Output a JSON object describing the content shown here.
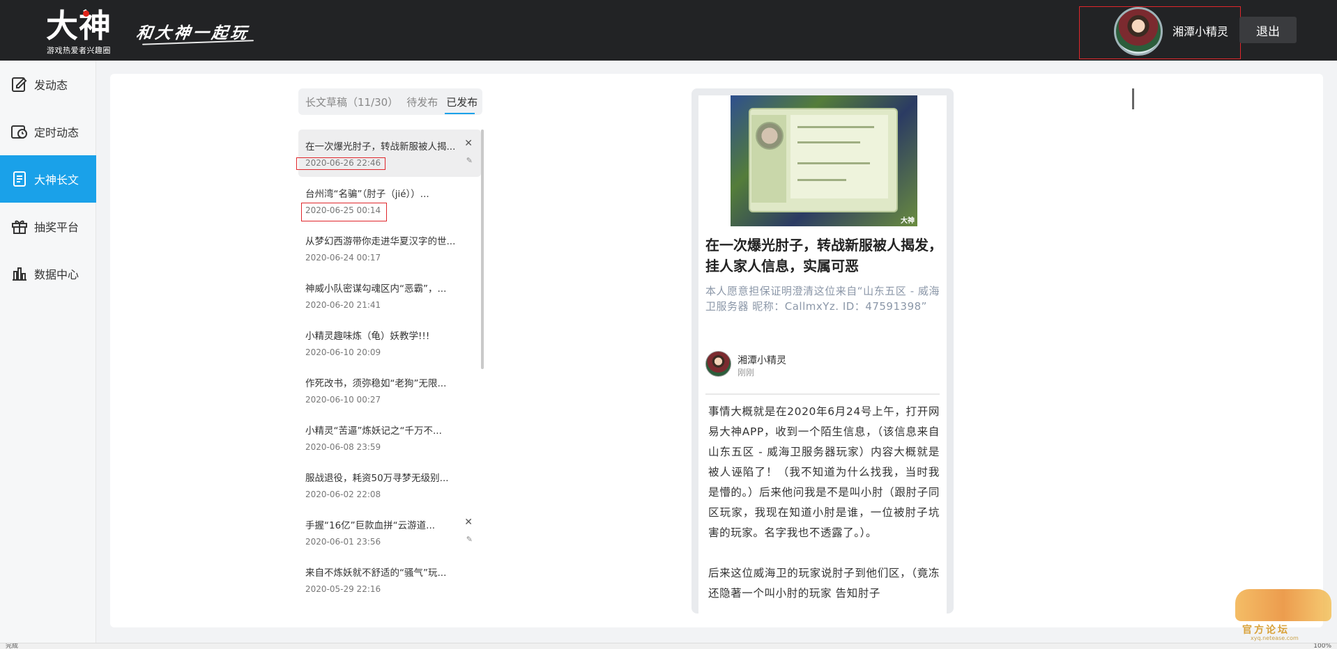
{
  "header": {
    "logo_text": "大神",
    "logo_sub": "游戏热爱者兴趣圈",
    "slogan": "和大神一起玩",
    "username": "湘潭小精灵",
    "logout_label": "退出"
  },
  "sidebar": {
    "items": [
      {
        "label": "发动态",
        "icon": "edit-icon"
      },
      {
        "label": "定时动态",
        "icon": "clock-icon"
      },
      {
        "label": "大神长文",
        "icon": "document-icon",
        "active": true
      },
      {
        "label": "抽奖平台",
        "icon": "gift-icon"
      },
      {
        "label": "数据中心",
        "icon": "bar-chart-icon"
      }
    ]
  },
  "tabs": {
    "drafts": "长文草稿（11/30）",
    "pending": "待发布",
    "published": "已发布"
  },
  "articles": [
    {
      "title": "在一次爆光肘子，转战新服被人揭...",
      "date": "2020-06-26 22:46"
    },
    {
      "title": "台州湾“名骗”（肘子（jié））...",
      "date": "2020-06-25 00:14"
    },
    {
      "title": "从梦幻西游带你走进华夏汉字的世...",
      "date": "2020-06-24 00:17"
    },
    {
      "title": "神威小队密谋勾魂区内“恶霸”，...",
      "date": "2020-06-20 21:41"
    },
    {
      "title": "小精灵趣味炼（龟）妖教学!!!",
      "date": "2020-06-10 20:09"
    },
    {
      "title": "作死改书，须弥稳如“老狗”无限...",
      "date": "2020-06-10 00:27"
    },
    {
      "title": "小精灵“苦逼”炼妖记之“千万不...",
      "date": "2020-06-08 23:59"
    },
    {
      "title": "服战退役，耗资50万寻梦无级别...",
      "date": "2020-06-02 22:08"
    },
    {
      "title": "手握“16亿”巨款血拼“云游道...",
      "date": "2020-06-01 23:56"
    },
    {
      "title": "来自不炼妖就不舒适的“骚气”玩...",
      "date": "2020-05-29 22:16"
    }
  ],
  "preview": {
    "cover_logo": "大神",
    "title": "在一次爆光肘子，转战新服被人揭发，挂人家人信息，实属可恶",
    "summary": "本人愿意担保证明澄清这位来自“山东五区 - 威海卫服务器 昵称：CallmxYz. ID：47591398”",
    "author": "湘潭小精灵",
    "time": "刚刚",
    "body1": "事情大概就是在2020年6月24号上午，打开网易大神APP，收到一个陌生信息，（该信息来自山东五区 - 威海卫服务器玩家）内容大概就是被人诬陷了！（我不知道为什么找我，当时我是懵的。）后来他问我是不是叫小肘（跟肘子同区玩家，我现在知道小肘是谁，一位被肘子坑害的玩家。名字我也不透露了。）。",
    "body2": "后来这位威海卫的玩家说肘子到他们区，（竟冻还隐著一个叫小肘的玩家 告知肘子"
  },
  "statusbar": {
    "left": "完成",
    "right": "100%"
  },
  "watermark": {
    "text": "官方论坛",
    "url": "xyq.netease.com"
  },
  "colors": {
    "accent": "#1aa1e9",
    "header_bg": "#222325",
    "highlight_box": "#e0262b"
  }
}
